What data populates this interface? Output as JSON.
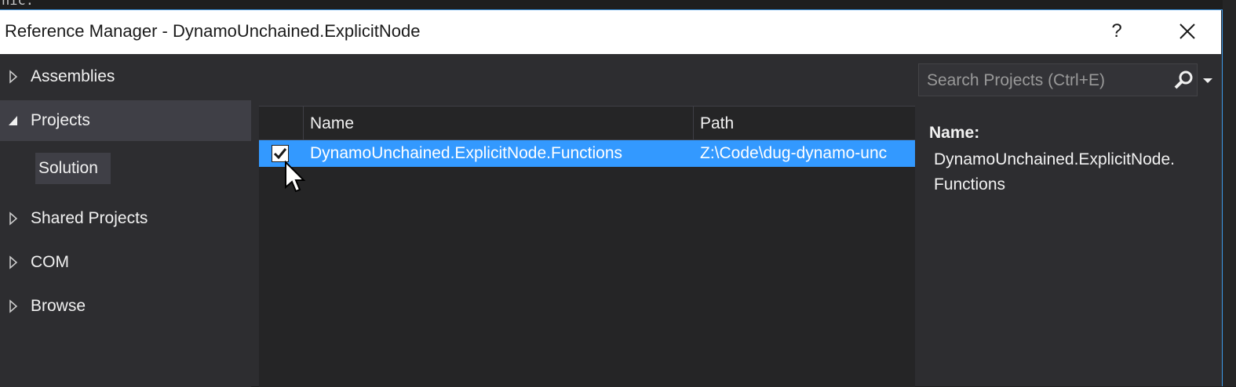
{
  "background": {
    "code_fragment": "nic:"
  },
  "dialog": {
    "title": "Reference Manager - DynamoUnchained.ExplicitNode",
    "help_label": "?",
    "accent_color": "#3399ff"
  },
  "nav": {
    "items": [
      {
        "label": "Assemblies",
        "expanded": false,
        "selected": false
      },
      {
        "label": "Projects",
        "expanded": true,
        "selected": true
      },
      {
        "label": "Shared Projects",
        "expanded": false,
        "selected": false
      },
      {
        "label": "COM",
        "expanded": false,
        "selected": false
      },
      {
        "label": "Browse",
        "expanded": false,
        "selected": false
      }
    ],
    "sub_items": [
      {
        "label": "Solution"
      }
    ]
  },
  "search": {
    "placeholder": "Search Projects (Ctrl+E)",
    "value": ""
  },
  "table": {
    "columns": [
      "Name",
      "Path"
    ],
    "rows": [
      {
        "checked": true,
        "name": "DynamoUnchained.ExplicitNode.Functions",
        "path": "Z:\\Code\\dug-dynamo-unc",
        "selected": true
      }
    ]
  },
  "details": {
    "label": "Name:",
    "value": "DynamoUnchained.ExplicitNode.Functions"
  }
}
